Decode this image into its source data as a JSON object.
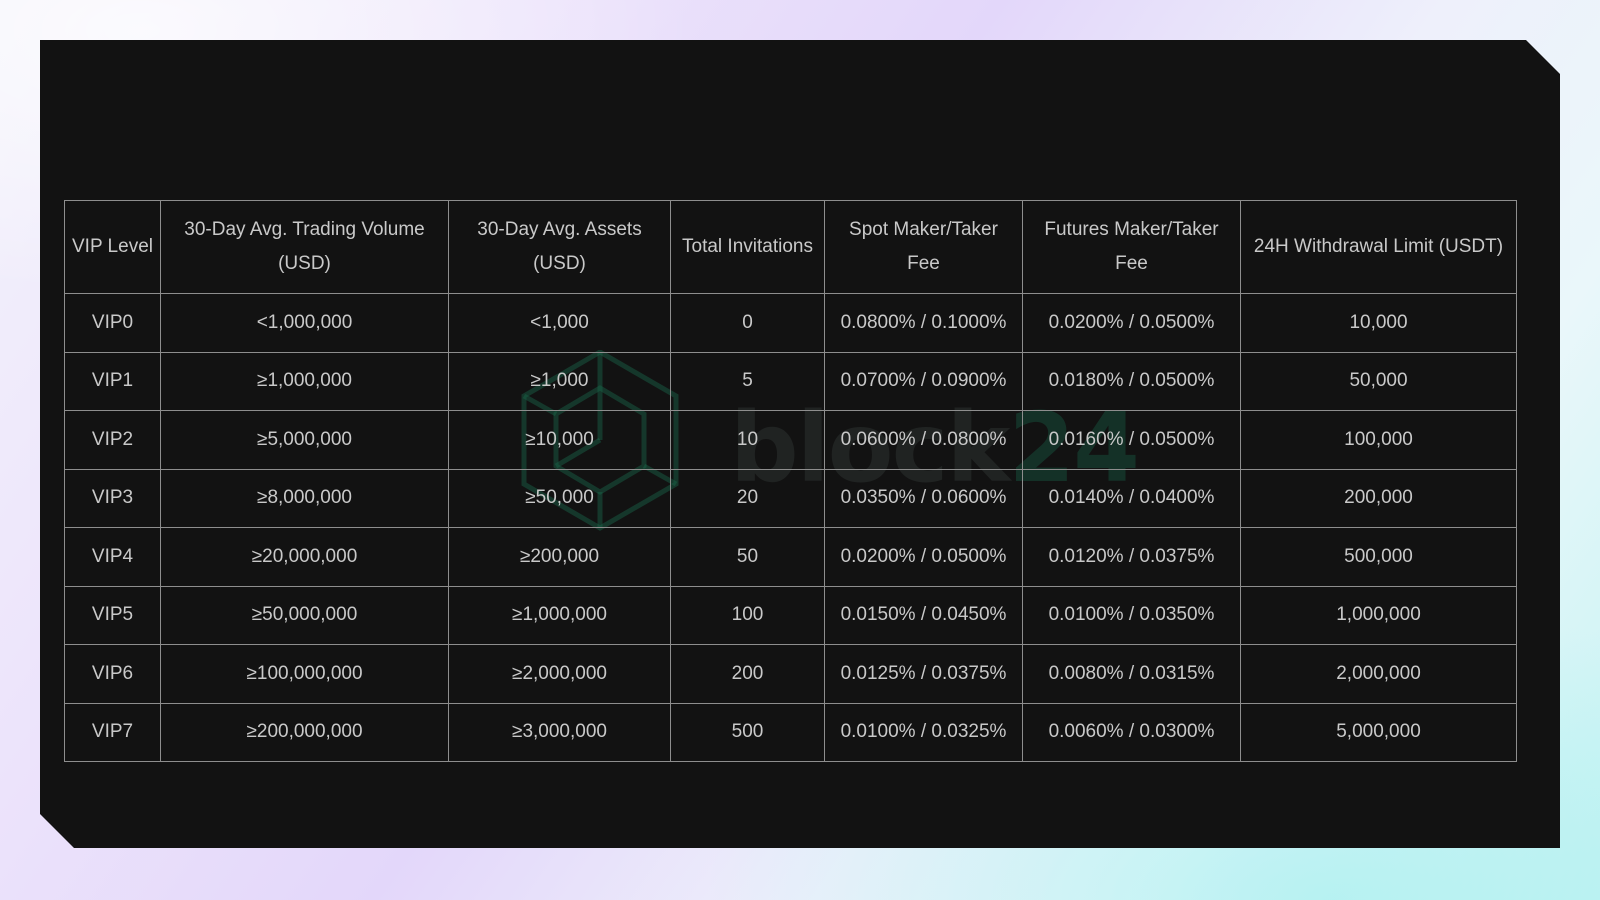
{
  "table": {
    "headers": [
      "VIP Level",
      "30-Day Avg. Trading Volume (USD)",
      "30-Day Avg. Assets (USD)",
      "Total Invitations",
      "Spot Maker/Taker Fee",
      "Futures Maker/Taker Fee",
      "24H Withdrawal Limit (USDT)"
    ],
    "rows": [
      [
        "VIP0",
        "<1,000,000",
        "<1,000",
        "0",
        "0.0800% / 0.1000%",
        "0.0200% / 0.0500%",
        "10,000"
      ],
      [
        "VIP1",
        "≥1,000,000",
        "≥1,000",
        "5",
        "0.0700% / 0.0900%",
        "0.0180% / 0.0500%",
        "50,000"
      ],
      [
        "VIP2",
        "≥5,000,000",
        "≥10,000",
        "10",
        "0.0600% / 0.0800%",
        "0.0160% / 0.0500%",
        "100,000"
      ],
      [
        "VIP3",
        "≥8,000,000",
        "≥50,000",
        "20",
        "0.0350% / 0.0600%",
        "0.0140% / 0.0400%",
        "200,000"
      ],
      [
        "VIP4",
        "≥20,000,000",
        "≥200,000",
        "50",
        "0.0200% / 0.0500%",
        "0.0120% / 0.0375%",
        "500,000"
      ],
      [
        "VIP5",
        "≥50,000,000",
        "≥1,000,000",
        "100",
        "0.0150% / 0.0450%",
        "0.0100% / 0.0350%",
        "1,000,000"
      ],
      [
        "VIP6",
        "≥100,000,000",
        "≥2,000,000",
        "200",
        "0.0125% / 0.0375%",
        "0.0080% / 0.0315%",
        "2,000,000"
      ],
      [
        "VIP7",
        "≥200,000,000",
        "≥3,000,000",
        "500",
        "0.0100% / 0.0325%",
        "0.0060% / 0.0300%",
        "5,000,000"
      ]
    ]
  },
  "watermark": {
    "text_main": "block",
    "text_accent": "24",
    "icon": "cube-logo-icon"
  },
  "colors": {
    "panel_bg": "#121212",
    "text": "#c9c9c9",
    "border": "#8e8e8e",
    "watermark_green": "#1a6e50"
  }
}
